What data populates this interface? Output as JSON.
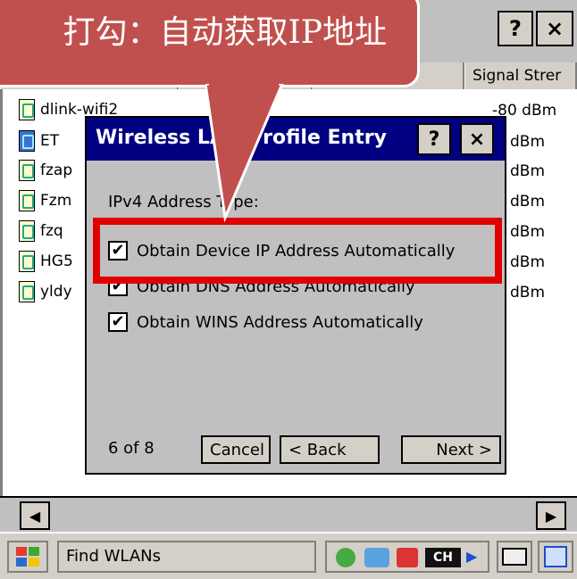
{
  "outer": {
    "help_label": "?",
    "close_label": "×",
    "column_signal": "Signal Strer"
  },
  "networks": [
    {
      "name": "dlink-wifi2",
      "signal": "-80 dBm",
      "icon": "wlan-icon"
    },
    {
      "name": "ET",
      "signal": "dBm",
      "icon": "wlan-secure-icon"
    },
    {
      "name": "fzap",
      "signal": "dBm",
      "icon": "wlan-icon"
    },
    {
      "name": "Fzm",
      "signal": "dBm",
      "icon": "wlan-icon"
    },
    {
      "name": "fzq",
      "signal": "dBm",
      "icon": "wlan-icon"
    },
    {
      "name": "HG5",
      "signal": "dBm",
      "icon": "wlan-icon"
    },
    {
      "name": "yldy",
      "signal": "dBm",
      "icon": "wlan-icon"
    }
  ],
  "dialog": {
    "title": "Wireless LAN Profile Entry",
    "help_label": "?",
    "close_label": "×",
    "section_label": "IPv4 Address Type:",
    "options": [
      {
        "label": "Obtain Device IP Address Automatically",
        "checked": true
      },
      {
        "label": "Obtain DNS Address Automatically",
        "checked": true
      },
      {
        "label": "Obtain WINS Address Automatically",
        "checked": true
      }
    ],
    "page_indicator": "6 of 8",
    "cancel_label": "Cancel",
    "back_label": "< Back",
    "next_label": "Next >"
  },
  "callout": {
    "text": "打勾：自动获取IP地址"
  },
  "taskbar": {
    "start_label": "Find WLANs",
    "lang": "CH"
  }
}
